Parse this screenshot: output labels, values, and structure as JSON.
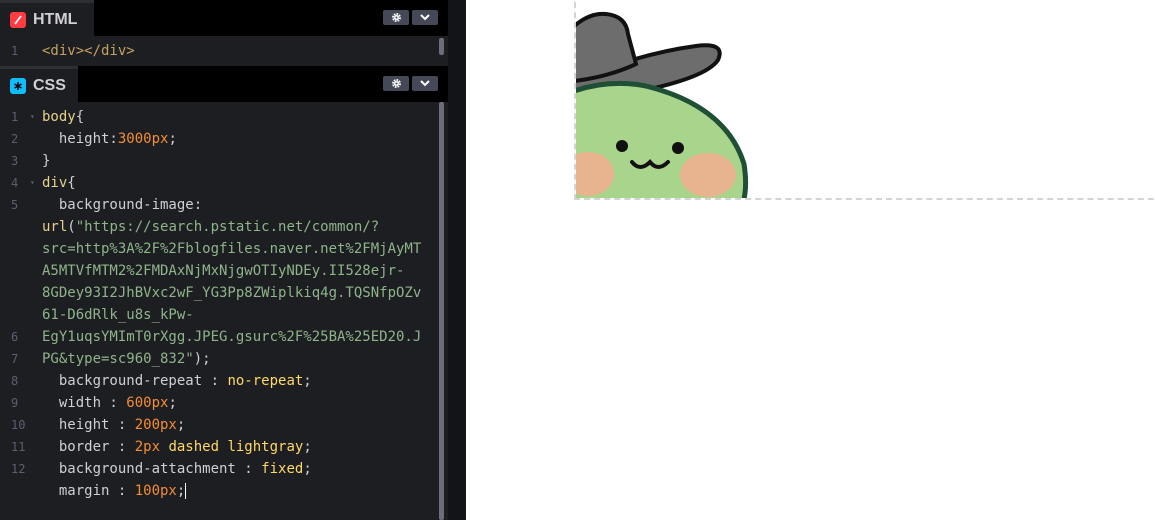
{
  "html_panel": {
    "title": "HTML",
    "icon": "html-icon",
    "settings_icon": "gear-icon",
    "collapse_icon": "chevron-down-icon",
    "lines": [
      {
        "n": "1",
        "tokens": [
          {
            "t": "<div></div>",
            "c": "tag"
          }
        ]
      }
    ]
  },
  "css_panel": {
    "title": "CSS",
    "icon": "css-icon",
    "settings_icon": "gear-icon",
    "collapse_icon": "chevron-down-icon",
    "line_numbers": [
      "1",
      "2",
      "3",
      "4",
      "5",
      "",
      "",
      "",
      "",
      "",
      "6",
      "7",
      "8",
      "9",
      "10",
      "11",
      "12"
    ],
    "lines": [
      {
        "tokens": [
          {
            "t": "body",
            "c": "sel"
          },
          {
            "t": "{",
            "c": "punc"
          }
        ]
      },
      {
        "tokens": [
          {
            "t": "  height:",
            "c": "prop"
          },
          {
            "t": "3000px",
            "c": "num"
          },
          {
            "t": ";",
            "c": "punc"
          }
        ]
      },
      {
        "tokens": [
          {
            "t": "}",
            "c": "punc"
          }
        ]
      },
      {
        "tokens": [
          {
            "t": "div",
            "c": "sel"
          },
          {
            "t": "{",
            "c": "punc"
          }
        ]
      },
      {
        "tokens": [
          {
            "t": "  background-image:",
            "c": "prop"
          }
        ]
      },
      {
        "tokens": [
          {
            "t": "url",
            "c": "fn"
          },
          {
            "t": "(",
            "c": "punc"
          },
          {
            "t": "\"https://search.pstatic.net/common/?",
            "c": "str"
          }
        ]
      },
      {
        "tokens": [
          {
            "t": "src=http%3A%2F%2Fblogfiles.naver.net%2FMjAyMT",
            "c": "str"
          }
        ]
      },
      {
        "tokens": [
          {
            "t": "A5MTVfMTM2%2FMDAxNjMxNjgwOTIyNDEy.II528ejr-",
            "c": "str"
          }
        ]
      },
      {
        "tokens": [
          {
            "t": "8GDey93I2JhBVxc2wF_YG3Pp8ZWiplkiq4g.TQSNfpOZv",
            "c": "str"
          }
        ]
      },
      {
        "tokens": [
          {
            "t": "61-D6dRlk_u8s_kPw-",
            "c": "str"
          }
        ]
      },
      {
        "tokens": [
          {
            "t": "EgY1uqsYMImT0rXgg.JPEG.gsurc%2F%25BA%25ED20.J",
            "c": "str"
          }
        ]
      },
      {
        "tokens": [
          {
            "t": "PG&type=sc960_832\"",
            "c": "str"
          },
          {
            "t": ");",
            "c": "punc"
          }
        ]
      },
      {
        "tokens": [
          {
            "t": "  background-repeat : ",
            "c": "prop"
          },
          {
            "t": "no-repeat",
            "c": "kw"
          },
          {
            "t": ";",
            "c": "punc"
          }
        ]
      },
      {
        "tokens": [
          {
            "t": "  width : ",
            "c": "prop"
          },
          {
            "t": "600px",
            "c": "num"
          },
          {
            "t": ";",
            "c": "punc"
          }
        ]
      },
      {
        "tokens": [
          {
            "t": "  height : ",
            "c": "prop"
          },
          {
            "t": "200px",
            "c": "num"
          },
          {
            "t": ";",
            "c": "punc"
          }
        ]
      },
      {
        "tokens": [
          {
            "t": "  border : ",
            "c": "prop"
          },
          {
            "t": "2px",
            "c": "num"
          },
          {
            "t": " dashed lightgray",
            "c": "kw"
          },
          {
            "t": ";",
            "c": "punc"
          }
        ]
      },
      {
        "tokens": [
          {
            "t": "  background-attachment : ",
            "c": "prop"
          },
          {
            "t": "fixed",
            "c": "kw"
          },
          {
            "t": ";",
            "c": "punc"
          }
        ]
      },
      {
        "tokens": [
          {
            "t": "  margin : ",
            "c": "prop"
          },
          {
            "t": "100px",
            "c": "num"
          },
          {
            "t": ";",
            "c": "punc"
          }
        ],
        "cursor": true
      },
      {
        "tokens": []
      }
    ]
  },
  "preview": {
    "image": "turtle-cowboy-hat-illustration"
  },
  "colors": {
    "editor_bg": "#1d1e22",
    "header_bg": "#000000",
    "html_icon": "#ff3c41",
    "css_icon": "#0ebeff",
    "button_bg": "#444857"
  }
}
